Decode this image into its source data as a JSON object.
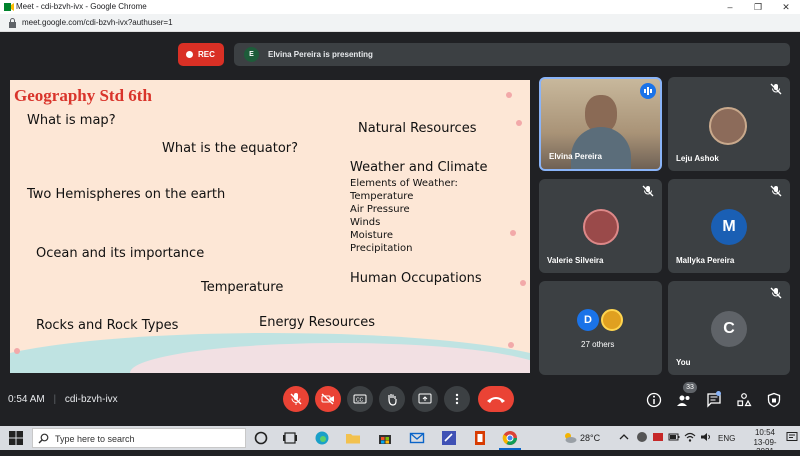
{
  "browser": {
    "title": "Meet - cdi-bzvh-ivx - Google Chrome",
    "url": "meet.google.com/cdi-bzvh-ivx?authuser=1"
  },
  "meet_top": {
    "rec_label": "REC",
    "presenter_initial": "E",
    "presenting_text": "Elvina Pereira is presenting"
  },
  "slide": {
    "title": "Geography Std 6th",
    "items": [
      "What is map?",
      "What is the equator?",
      "Natural Resources",
      "Weather and Climate",
      "Elements of Weather:",
      "Temperature",
      "Air Pressure",
      "Winds",
      "Moisture",
      "Precipitation",
      "Two Hemispheres on the earth",
      "Ocean and its importance",
      "Temperature",
      "Human Occupations",
      "Rocks and Rock Types",
      "Energy Resources"
    ]
  },
  "participants": {
    "elvina": "Elvina Pereira",
    "leju": "Leju Ashok",
    "valerie": "Valerie Silveira",
    "mallyka": "Mallyka Pereira",
    "mallyka_initial": "M",
    "others_label": "27 others",
    "others_initial": "D",
    "you": "You",
    "you_initial": "C"
  },
  "bottom": {
    "time": "0:54 AM",
    "meeting_code": "cdi-bzvh-ivx",
    "people_count": "33"
  },
  "taskbar": {
    "search_placeholder": "Type here to search",
    "weather": "28°C",
    "language": "ENG",
    "time": "10:54",
    "date": "13-09-2021"
  },
  "colors": {
    "meet_bg": "#202124",
    "tile_bg": "#3c4043",
    "end_call": "#ea4335",
    "rec": "#d93025",
    "slide_bg": "#fde7d6",
    "slide_title": "#d9342b"
  }
}
